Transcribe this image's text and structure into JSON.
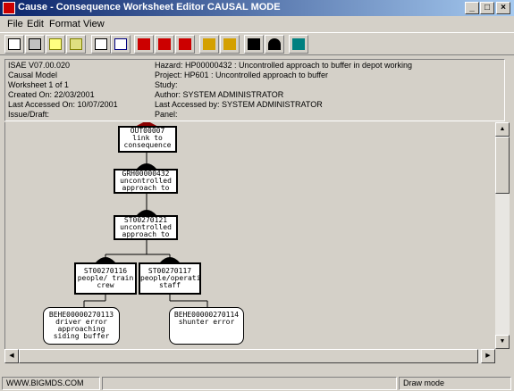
{
  "window": {
    "title": "Cause - Consequence Worksheet Editor CAUSAL MODE"
  },
  "menu": [
    "File",
    "Edit",
    "Format",
    "View"
  ],
  "toolbar_icons": [
    "new-icon",
    "print-icon",
    "edit-note-icon",
    "notes-icon",
    "checklist-icon",
    "list-icon",
    "red-gate-icon",
    "red-gate-and-icon",
    "red-gate-down-icon",
    "branch-icon",
    "tree-icon",
    "black-gate-icon",
    "black-gate-dome-icon",
    "exit-icon"
  ],
  "info": {
    "left": [
      "ISAE V07.00.020",
      "Causal Model",
      "Worksheet 1 of 1",
      "Created On: 22/03/2001",
      "Last Accessed On: 10/07/2001",
      "Issue/Draft:"
    ],
    "right": [
      "Hazard: HP00000432 : Uncontrolled approach to buffer in depot working",
      "Project: HP601 : Uncontrolled approach to buffer",
      "Study:",
      "Author: SYSTEM ADMINISTRATOR",
      "Last Accessed by: SYSTEM ADMINISTRATOR",
      "Panel:"
    ]
  },
  "diagram": {
    "top": {
      "id": "OUT00007",
      "text": "link to consequence"
    },
    "n1": {
      "id": "GRH00000432",
      "text": "uncontrolled approach to buffer in depot working"
    },
    "n2": {
      "id": "ST00270121",
      "text": "uncontrolled approach to siding buffer"
    },
    "n3": {
      "id": "ST00270116",
      "text": "people/ train crew"
    },
    "n4": {
      "id": "ST00270117",
      "text": "people/operations staff"
    },
    "leaf1": {
      "id": "BEHE00000270113",
      "text": "driver error approaching siding buffer"
    },
    "leaf2": {
      "id": "BEHE00000270114",
      "text": "shunter error"
    }
  },
  "status": {
    "left": "WWW.BIGMDS.COM",
    "middle": "",
    "right": "Draw mode"
  }
}
